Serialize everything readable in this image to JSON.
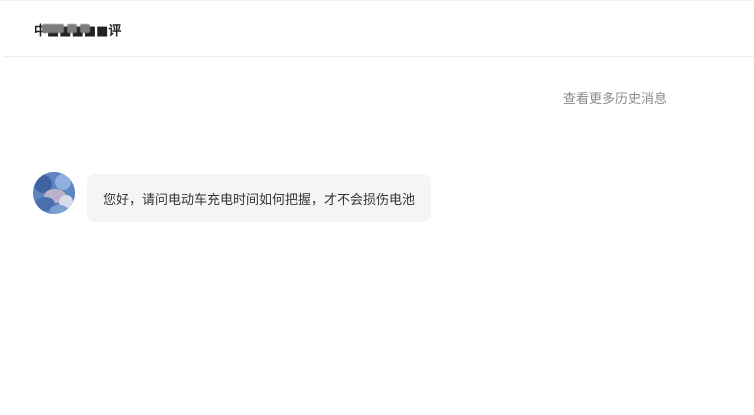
{
  "header": {
    "title": "中■■■■■评"
  },
  "conversation": {
    "history_link": "查看更多历史消息",
    "messages": [
      {
        "sender_avatar": "user-avatar-icon",
        "text": "您好，请问电动车充电时间如何把握，才不会损伤电池"
      }
    ]
  },
  "colors": {
    "bubble_bg": "#f5f5f5",
    "link_gray": "#8a8a8a",
    "avatar_blue": "#6c8fc4"
  }
}
